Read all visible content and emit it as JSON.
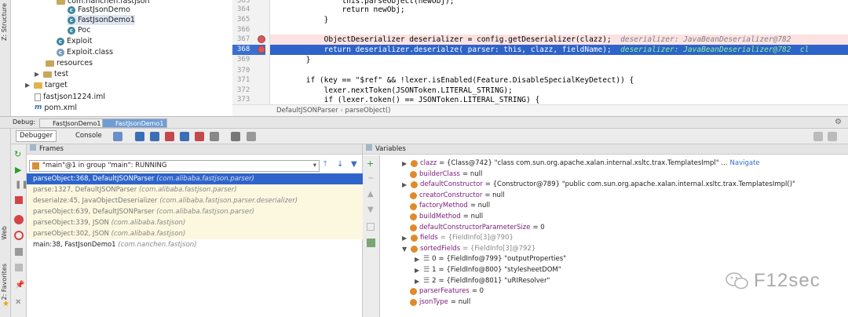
{
  "left_vertical_tabs": {
    "structure": "Z: Structure",
    "web": "Web",
    "favorites": "2: Favorites"
  },
  "project_tree": [
    {
      "label": "com.nanchen.fastjson",
      "icon": "folder-icon"
    },
    {
      "label": "FastJsonDemo",
      "icon": "class-icon"
    },
    {
      "label": "FastJsonDemo1",
      "icon": "class-icon"
    },
    {
      "label": "Poc",
      "icon": "class-icon"
    },
    {
      "label": "Exploit",
      "icon": "class-icon"
    },
    {
      "label": "Exploit.class",
      "icon": "class-file-icon"
    },
    {
      "label": "resources",
      "icon": "folder-icon"
    },
    {
      "label": "test",
      "icon": "folder-icon"
    },
    {
      "label": "target",
      "icon": "folder-icon"
    },
    {
      "label": "fastjson1224.iml",
      "icon": "file-icon"
    },
    {
      "label": "pom.xml",
      "icon": "maven-icon"
    }
  ],
  "editor": {
    "line_numbers": [
      "363",
      "364",
      "365",
      "366",
      "367",
      "368",
      "369",
      "370",
      "371",
      "372",
      "373"
    ],
    "lines": [
      "                this.parseObject(newObj);",
      "                return newObj;",
      "            }",
      "",
      "            ObjectDeserializer deserializer = config.getDeserializer(clazz);",
      "            return deserializer.deserialze( parser: this, clazz, fieldName);",
      "        }",
      "",
      "        if (key == \"$ref\" && !lexer.isEnabled(Feature.DisableSpecialKeyDetect)) {",
      "            lexer.nextToken(JSONToken.LITERAL_STRING);",
      "            if (lexer.token() == JSONToken.LITERAL_STRING) {"
    ],
    "inline_hint_367": "deserializer: JavaBeanDeserializer@782",
    "inline_hint_368": "deserializer: JavaBeanDeserializer@782  cl",
    "breadcrumb": [
      "DefaultJSONParser",
      "parseObject()"
    ]
  },
  "debug": {
    "label": "Debug:",
    "tabs": [
      "FastJsonDemo1",
      "FastJsonDemo1"
    ],
    "toolbar_tabs": [
      "Debugger",
      "Console"
    ],
    "frames_title": "Frames",
    "variables_title": "Variables",
    "thread_select": "\"main\"@1 in group \"main\": RUNNING",
    "frames": [
      {
        "text": "parseObject:368, DefaultJSONParser",
        "pkg": "(com.alibaba.fastjson.parser)",
        "state": "current"
      },
      {
        "text": "parse:1327, DefaultJSONParser",
        "pkg": "(com.alibaba.fastjson.parser)",
        "state": "library"
      },
      {
        "text": "deserialze:45, JavaObjectDeserializer",
        "pkg": "(com.alibaba.fastjson.parser.deserializer)",
        "state": "library"
      },
      {
        "text": "parseObject:639, DefaultJSONParser",
        "pkg": "(com.alibaba.fastjson.parser)",
        "state": "library"
      },
      {
        "text": "parseObject:339, JSON",
        "pkg": "(com.alibaba.fastjson)",
        "state": "library"
      },
      {
        "text": "parseObject:302, JSON",
        "pkg": "(com.alibaba.fastjson)",
        "state": "library"
      },
      {
        "text": "main:38, FastJsonDemo1",
        "pkg": "(com.nanchen.fastjson)",
        "state": "user"
      }
    ],
    "variables": [
      {
        "name": "clazz",
        "value": "= {Class@742} \"class com.sun.org.apache.xalan.internal.xsltc.trax.TemplatesImpl\" ... ",
        "link": "Navigate",
        "expand": true,
        "indent": 0
      },
      {
        "name": "builderClass",
        "value": "= null",
        "expand": false,
        "indent": 0
      },
      {
        "name": "defaultConstructor",
        "value": "= {Constructor@789} \"public com.sun.org.apache.xalan.internal.xsltc.trax.TemplatesImpl()\"",
        "expand": true,
        "indent": 0
      },
      {
        "name": "creatorConstructor",
        "value": "= null",
        "expand": false,
        "indent": 0
      },
      {
        "name": "factoryMethod",
        "value": "= null",
        "expand": false,
        "indent": 0
      },
      {
        "name": "buildMethod",
        "value": "= null",
        "expand": false,
        "indent": 0
      },
      {
        "name": "defaultConstructorParameterSize",
        "value": "= 0",
        "expand": false,
        "indent": 0
      },
      {
        "name": "fields",
        "value": "= {FieldInfo[3]@790}",
        "expand": true,
        "indent": 0
      },
      {
        "name": "sortedFields",
        "value": "= {FieldInfo[3]@792}",
        "expand": true,
        "open": true,
        "indent": 0
      },
      {
        "name": "0",
        "value": "= {FieldInfo@799} \"outputProperties\"",
        "expand": true,
        "indent": 1
      },
      {
        "name": "1",
        "value": "= {FieldInfo@800} \"stylesheetDOM\"",
        "expand": true,
        "indent": 1
      },
      {
        "name": "2",
        "value": "= {FieldInfo@801} \"uRIResolver\"",
        "expand": true,
        "indent": 1
      },
      {
        "name": "parserFeatures",
        "value": "= 0",
        "expand": false,
        "indent": 0
      },
      {
        "name": "jsonType",
        "value": "= null",
        "expand": false,
        "indent": 0
      }
    ]
  },
  "watermark": "F12sec"
}
